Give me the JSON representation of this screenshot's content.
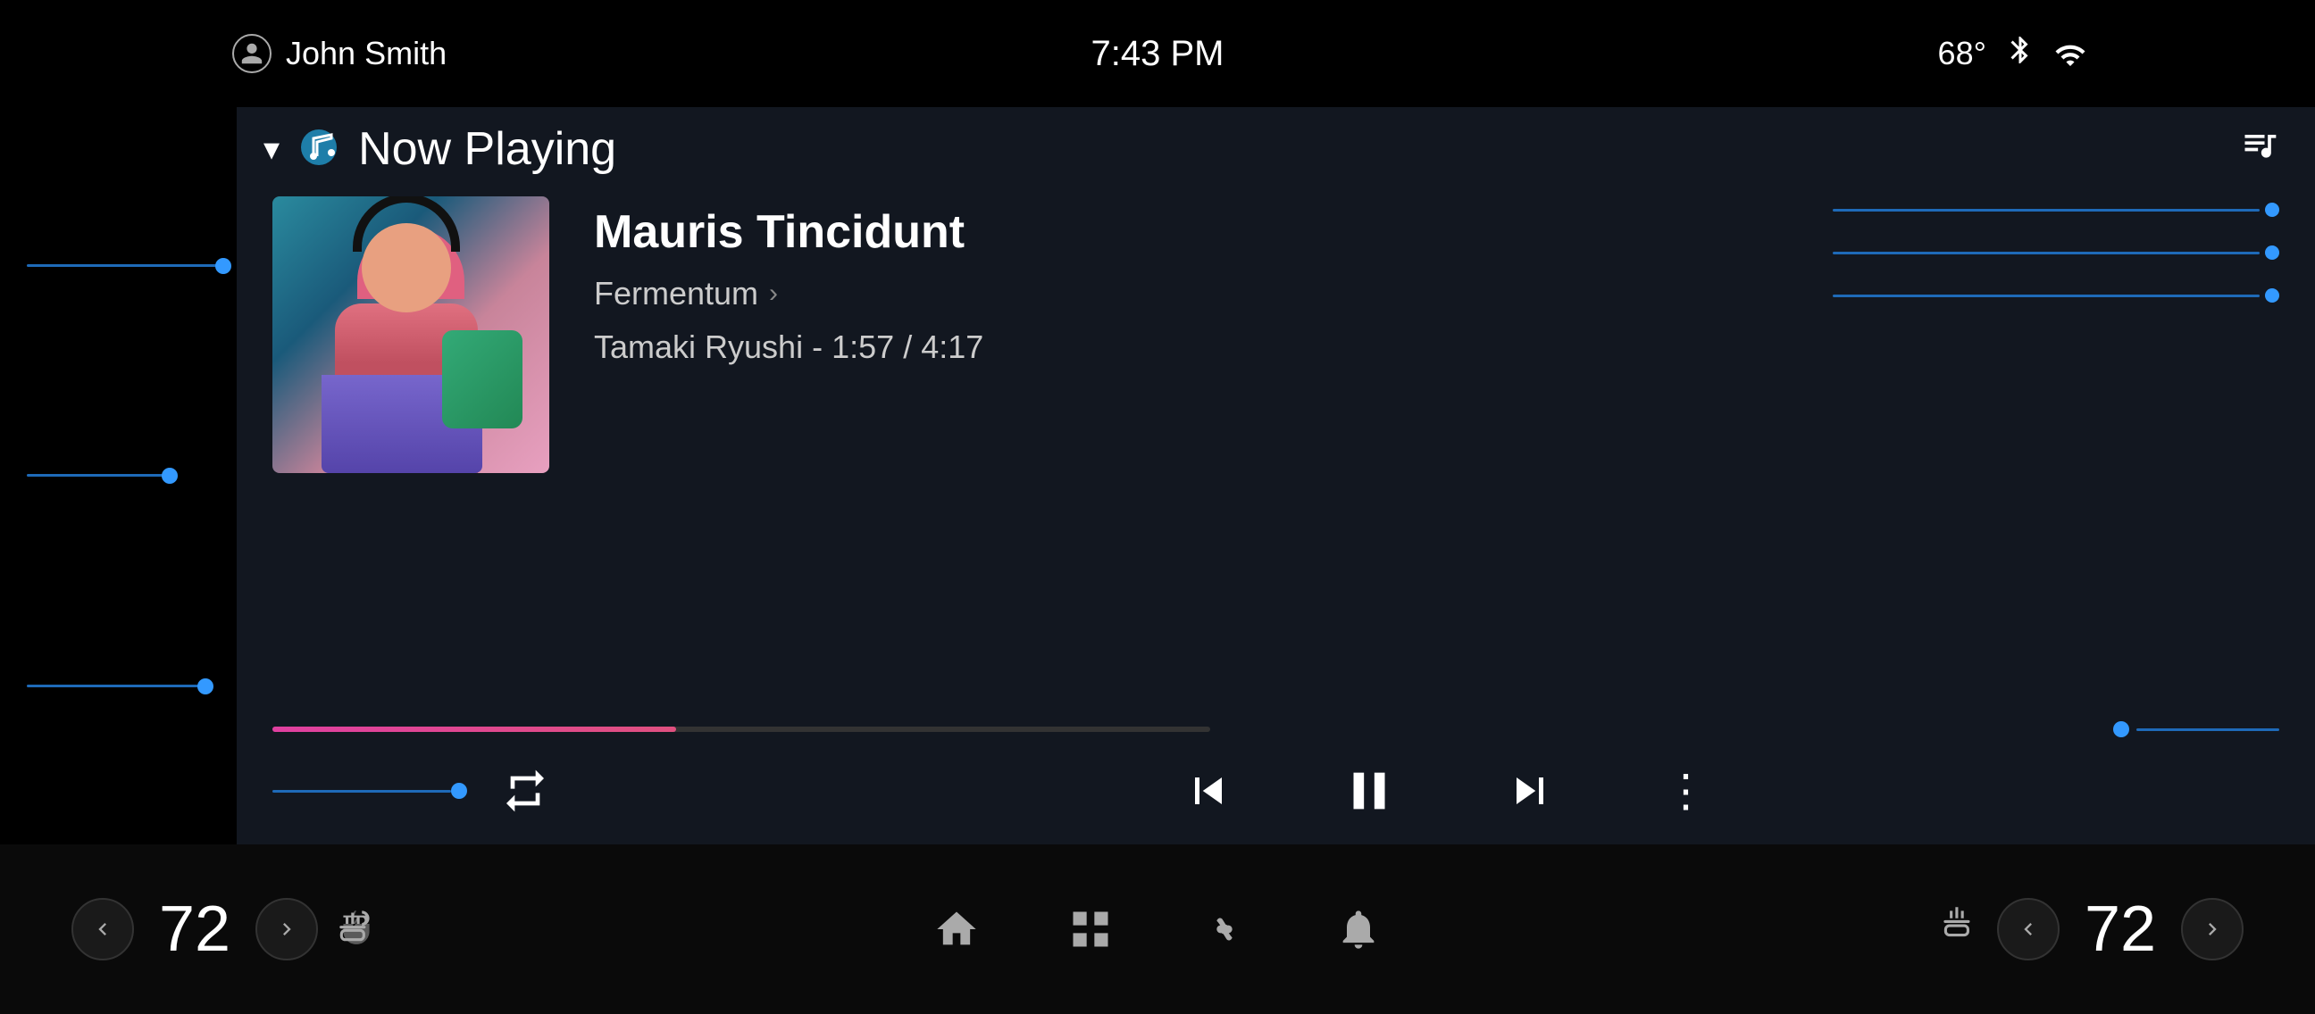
{
  "statusBar": {
    "username": "John Smith",
    "time": "7:43 PM",
    "temperature": "68°",
    "bluetooth": "bluetooth",
    "signal": "signal"
  },
  "header": {
    "title": "Now Playing",
    "chevronLabel": "▾",
    "queueIcon": "queue-music"
  },
  "track": {
    "name": "Mauris Tincidunt",
    "album": "Fermentum",
    "artist": "Tamaki Ryushi",
    "currentTime": "1:57",
    "totalTime": "4:17",
    "progressPercent": 43
  },
  "controls": {
    "repeatLabel": "⇄",
    "prevLabel": "skip-prev",
    "pauseLabel": "pause",
    "nextLabel": "skip-next",
    "moreLabel": "⋮"
  },
  "bottomBar": {
    "leftTemp": "72",
    "rightTemp": "72",
    "leftTempDecrLabel": "◀",
    "leftTempIncrLabel": "▶",
    "rightTempDecrLabel": "◀",
    "rightTempIncrLabel": "▶",
    "navHome": "home",
    "navGrid": "grid",
    "navFan": "fan",
    "navBell": "bell",
    "leftHeatIcon": "heat-left",
    "rightHeatIcon": "heat-right"
  }
}
